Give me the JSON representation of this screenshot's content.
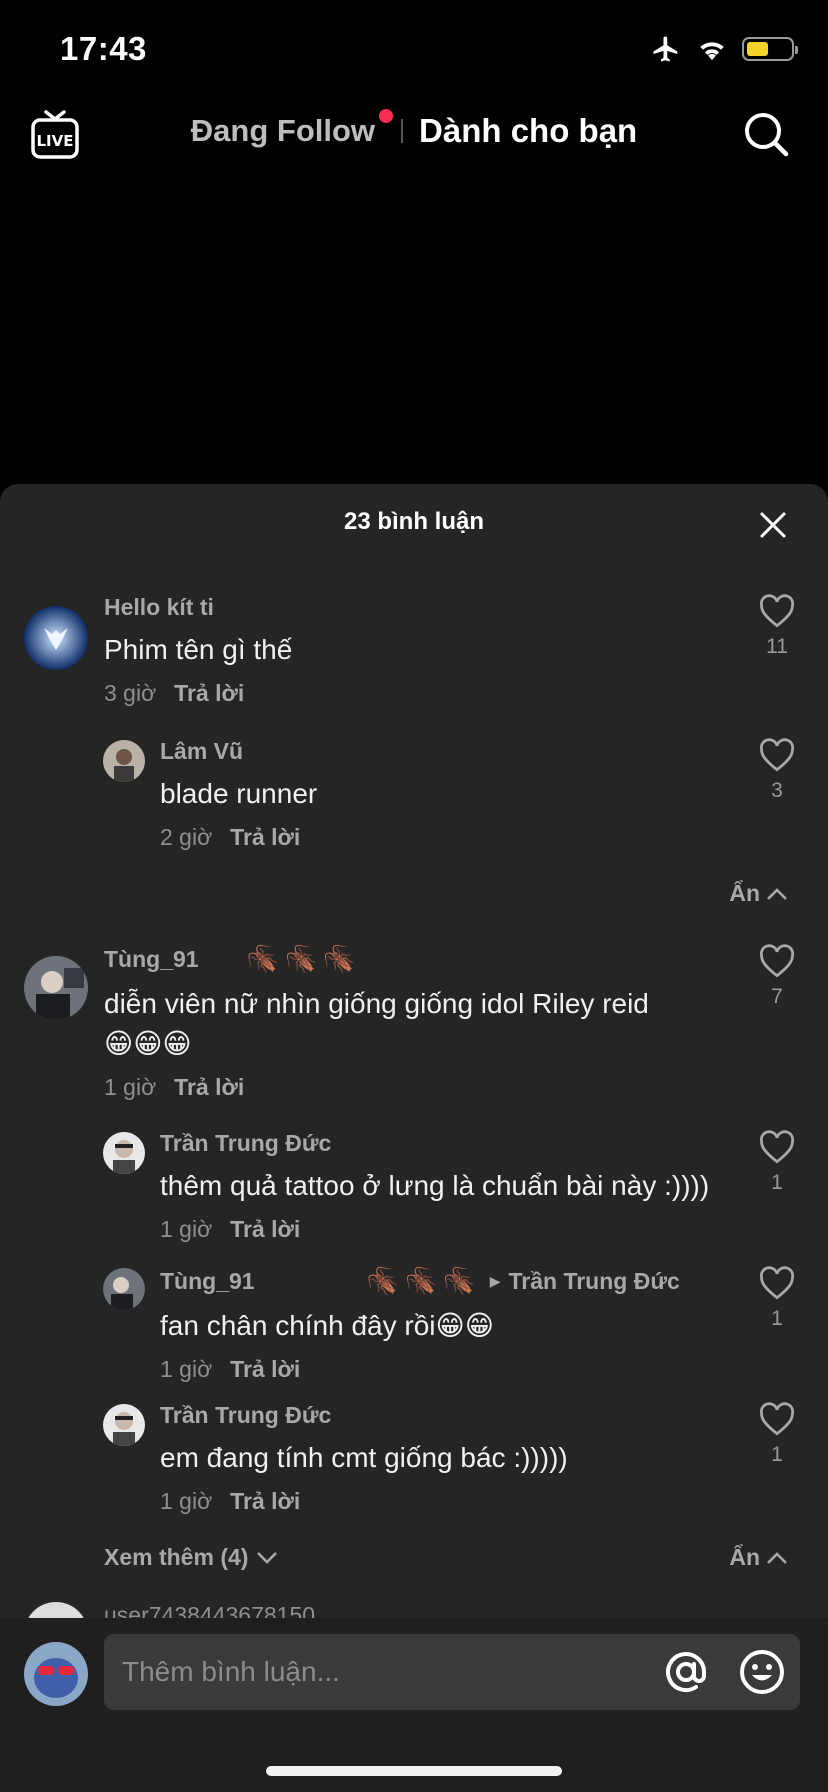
{
  "status": {
    "time": "17:43"
  },
  "nav": {
    "following": "Đang Follow",
    "for_you": "Dành cho bạn",
    "live": "LIVE"
  },
  "sheet": {
    "title": "23 bình luận"
  },
  "comments": [
    {
      "user": "Hello kít ti",
      "text": "Phim tên gì thế",
      "time": "3 giờ",
      "reply": "Trả lời",
      "likes": "11"
    },
    {
      "user": "Lâm Vũ",
      "text": "blade runner",
      "time": "2 giờ",
      "reply": "Trả lời",
      "likes": "3"
    },
    {
      "user": "Tùng_91",
      "text": "diễn viên nữ nhìn giống giống idol Riley reid",
      "emoji": "😁😁😁",
      "time": "1 giờ",
      "reply": "Trả lời",
      "likes": "7"
    },
    {
      "user": "Trần Trung Đức",
      "text": "thêm quả tattoo ở lưng là chuẩn bài này :))))",
      "time": "1 giờ",
      "reply": "Trả lời",
      "likes": "1"
    },
    {
      "user": "Tùng_91",
      "reply_to": "Trần Trung Đức",
      "text": "fan chân chính đây rồi😁😁",
      "time": "1 giờ",
      "reply": "Trả lời",
      "likes": "1"
    },
    {
      "user": "Trần Trung Đức",
      "text": "em đang tính cmt giống bác :)))))",
      "time": "1 giờ",
      "reply": "Trả lời",
      "likes": "1"
    }
  ],
  "controls": {
    "hide": "Ẩn",
    "view_more": "Xem thêm (4)",
    "peek_user": "user7438443678150"
  },
  "input": {
    "placeholder": "Thêm bình luận..."
  },
  "colors": {
    "sheet_bg": "#252525",
    "accent": "#fe2c55",
    "battery": "#f5d328"
  }
}
